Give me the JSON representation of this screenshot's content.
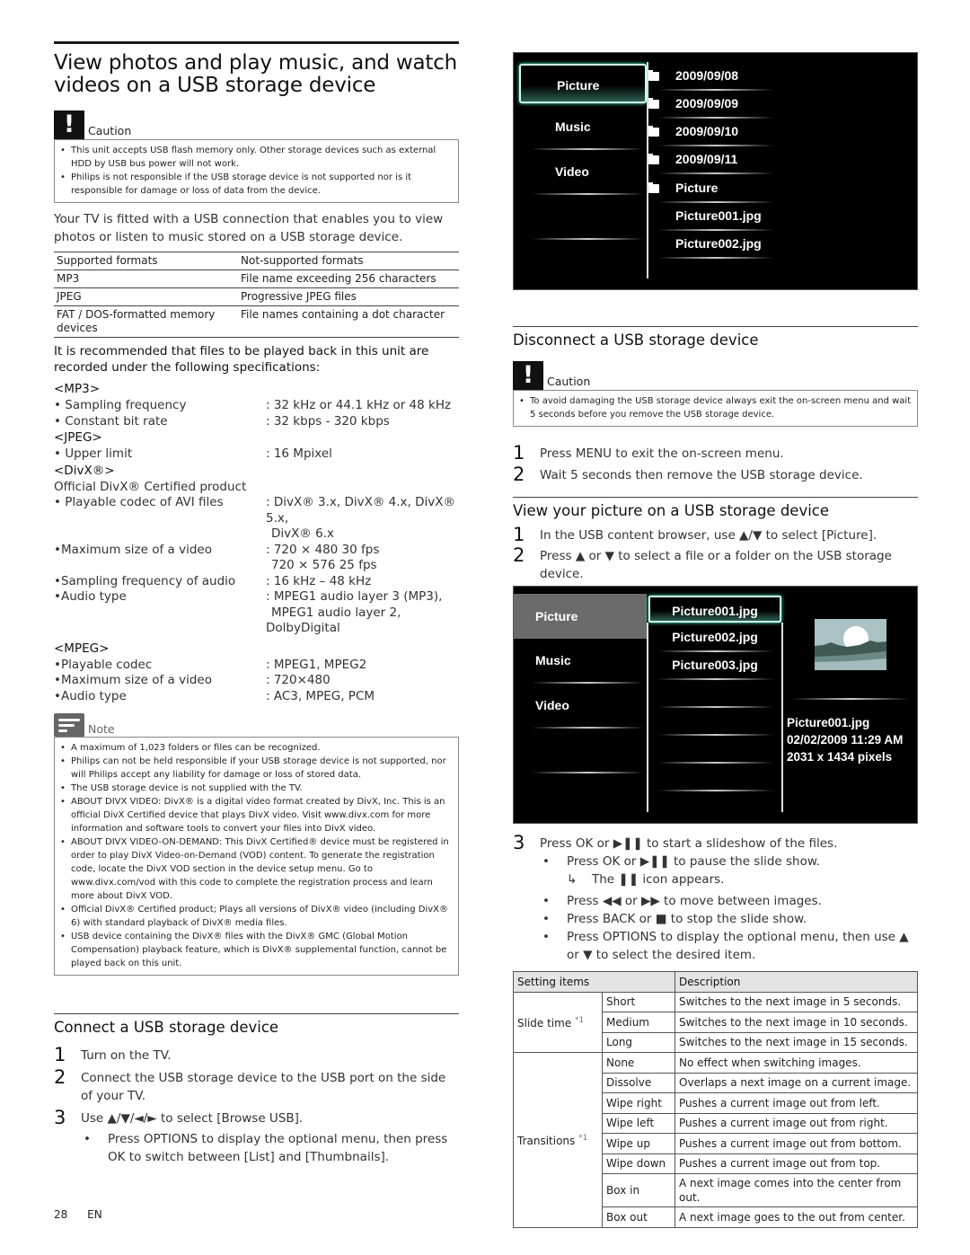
{
  "page": {
    "title": "View photos and play music, and watch videos on a USB storage device",
    "footer": {
      "page_number": "28",
      "language": "EN"
    }
  },
  "caution_1": {
    "label": "Caution",
    "items": [
      "This unit accepts USB flash memory only. Other storage devices such as external HDD by USB bus power will not work.",
      "Philips is not responsible if the USB storage device is not supported nor is it responsible for damage or loss of data from the device."
    ]
  },
  "intro": "Your TV is fitted with a USB connection that enables you to view photos or listen to music stored on a USB storage device.",
  "formats_table": {
    "headers": [
      "Supported formats",
      "Not-supported formats"
    ],
    "rows": [
      [
        "MP3",
        "File name exceeding 256 characters"
      ],
      [
        "JPEG",
        "Progressive JPEG files"
      ],
      [
        "FAT / DOS-formatted memory devices",
        "File names containing a dot character"
      ]
    ]
  },
  "specs_intro": "It is recommended that files to be played back in this unit are recorded under the following specifications:",
  "specs": {
    "mp3": {
      "heading": "<MP3>",
      "rows": [
        {
          "key": "• Sampling frequency",
          "value": ": 32 kHz or 44.1 kHz or 48 kHz"
        },
        {
          "key": "• Constant bit rate",
          "value": ": 32 kbps - 320 kbps"
        }
      ]
    },
    "jpeg": {
      "heading": "<JPEG>",
      "rows": [
        {
          "key": "• Upper limit",
          "value": ": 16 Mpixel"
        }
      ]
    },
    "divx": {
      "heading": "<DivX®>",
      "subheading": "Official DivX® Certified product",
      "rows": [
        {
          "key": "• Playable codec of AVI files",
          "value": ": DivX® 3.x, DivX® 4.x, DivX® 5.x,",
          "value2": "DivX® 6.x"
        },
        {
          "key": "•Maximum size of a video",
          "value": ": 720 × 480 30 fps",
          "value2": "720 × 576 25 fps"
        },
        {
          "key": "•Sampling frequency of audio",
          "value": ": 16 kHz – 48 kHz"
        },
        {
          "key": "•Audio type",
          "value": ": MPEG1 audio layer 3 (MP3),",
          "value2": "MPEG1 audio layer 2, DolbyDigital"
        }
      ]
    },
    "mpeg": {
      "heading": "<MPEG>",
      "rows": [
        {
          "key": "•Playable codec",
          "value": ": MPEG1, MPEG2"
        },
        {
          "key": "•Maximum size of a video",
          "value": ": 720×480"
        },
        {
          "key": "•Audio type",
          "value": ": AC3, MPEG, PCM"
        }
      ]
    }
  },
  "note": {
    "label": "Note",
    "items": [
      "A maximum of 1,023 folders or files can be recognized.",
      "Philips can not be held responsible if your USB storage device is not supported, nor will Philips accept any liability for damage or loss of stored data.",
      "The USB storage device is not supplied with the TV.",
      "ABOUT DIVX VIDEO: DivX® is a digital video format created by DivX, Inc. This is an official DivX Certified device that plays DivX video. Visit www.divx.com for more information and software tools to convert your files into DivX video.",
      "ABOUT DIVX VIDEO-ON-DEMAND: This DivX Certified® device must be registered in order to play DivX Video-on-Demand (VOD) content. To generate the registration code, locate the DivX VOD section in the device setup menu. Go to www.divx.com/vod with this code to complete the registration process and learn more about DivX VOD.",
      "Official DivX® Certified product; Plays all versions of DivX® video (including DivX® 6) with standard playback of DivX® media files.",
      "USB device containing the DivX® files with the DivX® GMC (Global Motion Compensation) playback feature, which is DivX® supplemental function, cannot be played back on this unit."
    ]
  },
  "connect": {
    "heading": "Connect a USB storage device",
    "steps": [
      {
        "num": "1",
        "text": "Turn on the TV."
      },
      {
        "num": "2",
        "text": "Connect the USB storage device to the USB port on the side of your TV."
      },
      {
        "num": "3",
        "text": "Use ▲/▼/◄/► to select [Browse USB]."
      }
    ],
    "sub_bullets": [
      "Press OPTIONS to display the optional menu, then press OK to switch between [List] and [Thumbnails]."
    ]
  },
  "tv_browser_1": {
    "categories": [
      "Picture",
      "Music",
      "Video"
    ],
    "selected_category": "Picture",
    "entries": [
      {
        "name": "2009/09/08",
        "type": "folder"
      },
      {
        "name": "2009/09/09",
        "type": "folder"
      },
      {
        "name": "2009/09/10",
        "type": "folder"
      },
      {
        "name": "2009/09/11",
        "type": "folder"
      },
      {
        "name": "Picture",
        "type": "folder"
      },
      {
        "name": "Picture001.jpg",
        "type": "file"
      },
      {
        "name": "Picture002.jpg",
        "type": "file"
      }
    ]
  },
  "disconnect": {
    "heading": "Disconnect a USB storage device",
    "caution_label": "Caution",
    "caution_items": [
      "To avoid damaging the USB storage device always exit the on-screen menu and wait 5 seconds before you remove the USB storage device."
    ],
    "steps": [
      {
        "num": "1",
        "text": "Press MENU to exit the on-screen menu."
      },
      {
        "num": "2",
        "text": "Wait 5 seconds then remove the USB storage device."
      }
    ]
  },
  "view_picture": {
    "heading": "View your picture on a USB storage device",
    "steps": [
      {
        "num": "1",
        "text": "In the USB content browser, use ▲/▼ to select [Picture]."
      },
      {
        "num": "2",
        "text": "Press ▲ or ▼ to select a file or a folder on the USB storage device."
      },
      {
        "num": "3",
        "text": "Press OK or ▶❚❚ to start a slideshow of the files."
      }
    ],
    "sub_bullets": [
      "Press OK or ▶❚❚ to pause the slide show.",
      "Press ◀◀ or ▶▶ to move between images.",
      "Press BACK or ■ to stop the slide show.",
      "Press OPTIONS to display the optional menu, then use ▲ or ▼ to select the desired item."
    ],
    "result_arrow": "↳",
    "result_text": "The ❚❚ icon appears."
  },
  "tv_browser_2": {
    "categories": [
      "Picture",
      "Music",
      "Video"
    ],
    "selected_category": "Picture",
    "files": [
      "Picture001.jpg",
      "Picture002.jpg",
      "Picture003.jpg"
    ],
    "selected_file": "Picture001.jpg",
    "preview_info": {
      "name": "Picture001.jpg",
      "date": "02/02/2009 11:29 AM",
      "size": "2031 x 1434 pixels"
    }
  },
  "settings_table": {
    "headers": [
      "Setting items",
      "Description"
    ],
    "groups": [
      {
        "name": "Slide time",
        "footnote": "*1",
        "options": [
          {
            "option": "Short",
            "description": "Switches to the next image in 5 seconds."
          },
          {
            "option": "Medium",
            "description": "Switches to the next image in 10 seconds."
          },
          {
            "option": "Long",
            "description": "Switches to the next image in 15 seconds."
          }
        ]
      },
      {
        "name": "Transitions",
        "footnote": "*1",
        "options": [
          {
            "option": "None",
            "description": "No effect when switching images."
          },
          {
            "option": "Dissolve",
            "description": "Overlaps a next image on a current image."
          },
          {
            "option": "Wipe right",
            "description": "Pushes a current image out from left."
          },
          {
            "option": "Wipe left",
            "description": "Pushes a current image out from right."
          },
          {
            "option": "Wipe up",
            "description": "Pushes a current image out from bottom."
          },
          {
            "option": "Wipe down",
            "description": "Pushes a current image out from top."
          },
          {
            "option": "Box in",
            "description": "A next image comes into the center from out."
          },
          {
            "option": "Box out",
            "description": "A next image goes to the out from center."
          }
        ]
      }
    ]
  }
}
